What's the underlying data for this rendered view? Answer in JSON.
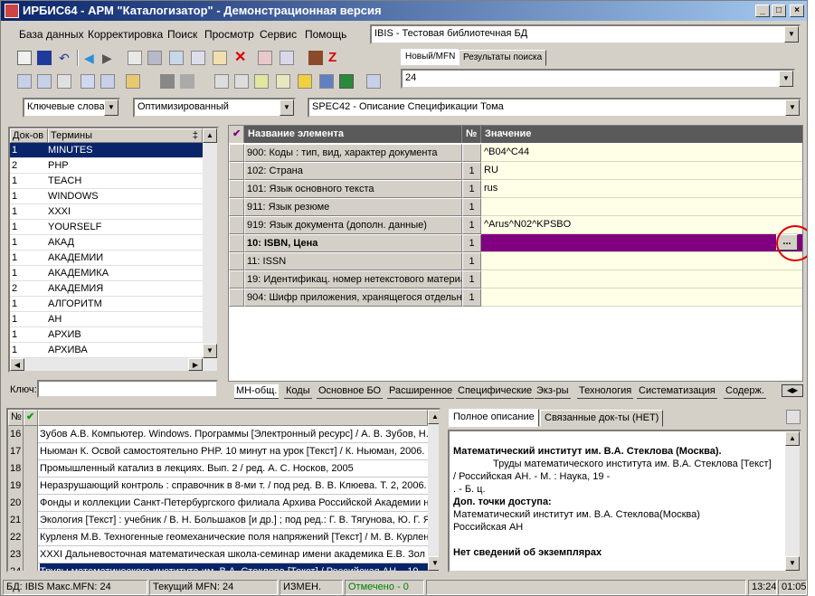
{
  "window": {
    "title": "ИРБИС64 - АРМ \"Каталогизатор\" - Демонстрационная версия"
  },
  "menu": [
    "База данных",
    "Корректировка",
    "Поиск",
    "Просмотр",
    "Сервис",
    "Помощь"
  ],
  "db_selector": {
    "value": "IBIS - Тестовая библиотечная БД"
  },
  "search_tabs": [
    "Новый/MFN",
    "Результаты поиска"
  ],
  "mfn_input": {
    "value": "24"
  },
  "dictionary": {
    "mode": "Ключевые слова",
    "optimization": "Оптимизированный",
    "worksheet": "SPEC42 - Описание Спецификации Тома",
    "headers": [
      "Док-ов",
      "Термины"
    ],
    "rows": [
      {
        "count": "1",
        "term": "MINUTES"
      },
      {
        "count": "2",
        "term": "PHP"
      },
      {
        "count": "1",
        "term": "TEACH"
      },
      {
        "count": "1",
        "term": "WINDOWS"
      },
      {
        "count": "1",
        "term": "XXXI"
      },
      {
        "count": "1",
        "term": "YOURSELF"
      },
      {
        "count": "1",
        "term": "АКАД"
      },
      {
        "count": "1",
        "term": "АКАДЕМИИ"
      },
      {
        "count": "1",
        "term": "АКАДЕМИКА"
      },
      {
        "count": "2",
        "term": "АКАДЕМИЯ"
      },
      {
        "count": "1",
        "term": "АЛГОРИТМ"
      },
      {
        "count": "1",
        "term": "АН"
      },
      {
        "count": "1",
        "term": "АРХИВ"
      },
      {
        "count": "1",
        "term": "АРХИВА"
      }
    ],
    "key_label": "Ключ:",
    "key_value": ""
  },
  "fields": {
    "headers": [
      "Название элемента",
      "№",
      "Значение"
    ],
    "rows": [
      {
        "name": "900: Коды : тип, вид, характер документа",
        "num": "",
        "value": "^B04^C44"
      },
      {
        "name": "102: Страна",
        "num": "1",
        "value": "RU"
      },
      {
        "name": "101: Язык основного текста",
        "num": "1",
        "value": "rus"
      },
      {
        "name": "911: Язык резюме",
        "num": "1",
        "value": ""
      },
      {
        "name": "919: Язык документа (дополн. данные)",
        "num": "1",
        "value": "^Arus^N02^KPSBO"
      },
      {
        "name": "10: ISBN, Цена",
        "num": "1",
        "value": ""
      },
      {
        "name": "11: ISSN",
        "num": "1",
        "value": ""
      },
      {
        "name": "19: Идентификац. номер нетекстового материала",
        "num": "1",
        "value": ""
      },
      {
        "name": "904: Шифр приложения, хранящегося отдельно",
        "num": "1",
        "value": ""
      }
    ],
    "ellipsis": "..."
  },
  "worksheet_tabs": [
    "МН-общ.",
    "Коды",
    "Основное БО",
    "Расширенное",
    "Специфические",
    "Экз-ры",
    "Технология",
    "Систематизация",
    "Содерж."
  ],
  "doc_list": {
    "header_num": "№",
    "rows": [
      {
        "n": "16",
        "text": "Зубов А.В. Компьютер. Windows. Программы [Электронный ресурс] / А. В. Зубов, Н."
      },
      {
        "n": "17",
        "text": "Ньюман К. Освой самостоятельно PHP. 10 минут на урок [Текст] / К. Ньюман, 2006."
      },
      {
        "n": "18",
        "text": "Промышленный катализ в лекциях. Вып. 2 / ред. А. С. Носков, 2005"
      },
      {
        "n": "19",
        "text": "Неразрушающий контроль : справочник в 8-ми т. / под ред. В. В. Клюева. Т. 2, 2006."
      },
      {
        "n": "20",
        "text": "Фонды и коллекции Санкт-Петербургского филиала Архива Российской Академии н"
      },
      {
        "n": "21",
        "text": "Экология [Текст] : учебник / В. Н. Большаков [и др.] ; под ред.: Г. В. Тягунова, Ю. Г. Я"
      },
      {
        "n": "22",
        "text": "Курленя М.В. Техногенные геомеханические поля напряжений [Текст] / М. В. Курлен"
      },
      {
        "n": "23",
        "text": "XXXI Дальневосточная математическая школа-семинар имени академика Е.В. Зол"
      },
      {
        "n": "24",
        "text": "Труды математического института им. В.А. Стеклова [Текст] / Российская АН. , 19"
      }
    ]
  },
  "desc_tabs": [
    "Полное описание",
    "Связанные док-ты (НЕТ)"
  ],
  "description": {
    "line1": "Математический институт им. В.А. Стеклова (Москва).",
    "line2": "Труды математического института им. В.А. Стеклова [Текст]",
    "line3": "/ Российская АН. - М. : Наука, 19 -",
    "line4": ". - Б. ц.",
    "line5": "Доп. точки доступа:",
    "line6": "Математический институт им. В.А. Стеклова(Москва)",
    "line7": "Российская АН",
    "line8": "Нет сведений об экземплярах"
  },
  "status": {
    "db": "БД: IBIS Макс.MFN: 24",
    "current": "Текущий MFN: 24",
    "changed": "ИЗМЕН.",
    "marked": "Отмечено - 0",
    "time": "13:24",
    "date": "01:05"
  },
  "colors": {
    "title_start": "#0a246a",
    "active_value": "#800080",
    "value_bg": "#ffffe8",
    "marked_text": "#008000",
    "highlight_circle": "#e00000"
  }
}
